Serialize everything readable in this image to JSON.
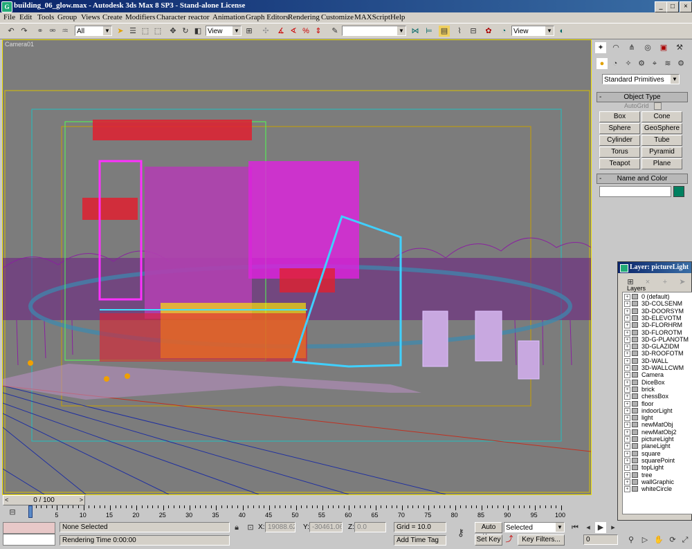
{
  "window": {
    "title": "building_06_glow.max - Autodesk 3ds Max 8 SP3  -  Stand-alone License",
    "minimize": "_",
    "maximize": "□",
    "close": "×"
  },
  "menu": [
    "File",
    "Edit",
    "Tools",
    "Group",
    "Views",
    "Create",
    "Modifiers",
    "Character",
    "reactor",
    "Animation",
    "Graph Editors",
    "Rendering",
    "Customize",
    "MAXScript",
    "Help"
  ],
  "toolbar": {
    "selection_filter": "All",
    "ref_coord": "View",
    "named_selection": "",
    "render_view": "View"
  },
  "viewport": {
    "label": "Camera01",
    "background": "#7c7c7c"
  },
  "command_panel": {
    "category": "Standard Primitives",
    "object_type_header": "Object Type",
    "autogrid_label": "AutoGrid",
    "buttons": [
      "Box",
      "Cone",
      "Sphere",
      "GeoSphere",
      "Cylinder",
      "Tube",
      "Torus",
      "Pyramid",
      "Teapot",
      "Plane"
    ],
    "name_color_header": "Name and Color",
    "object_name": "",
    "object_color": "#008060"
  },
  "layer_window": {
    "title": "Layer: pictureLight",
    "header": "Layers",
    "layers": [
      "0 (default)",
      "3D-COLSENM",
      "3D-DOORSYM",
      "3D-ELEVOTM",
      "3D-FLORHRM",
      "3D-FLOROTM",
      "3D-G-PLANOTM",
      "3D-GLAZIDM",
      "3D-ROOFOTM",
      "3D-WALL",
      "3D-WALLCWM",
      "Camera",
      "DiceBox",
      "brick",
      "chessBox",
      "floor",
      "indoorLight",
      "light",
      "newMatObj",
      "newMatObj2",
      "pictureLight",
      "planeLight",
      "square",
      "squarePoint",
      "topLight",
      "tree",
      "wallGraphic",
      "whiteCircle"
    ]
  },
  "timeline": {
    "slider_label": "0 / 100",
    "ticks": [
      "0",
      "5",
      "10",
      "15",
      "20",
      "25",
      "30",
      "35",
      "40",
      "45",
      "50",
      "55",
      "60",
      "65",
      "70",
      "75",
      "80",
      "85",
      "90",
      "95",
      "100"
    ]
  },
  "status": {
    "selection": "None Selected",
    "render_time": "Rendering Time  0:00:00",
    "x_label": "X:",
    "x_value": "19088.621",
    "y_label": "Y:",
    "y_value": "-30461.064",
    "z_label": "Z:",
    "z_value": "0.0",
    "grid": "Grid = 10.0",
    "add_time_tag": "Add Time Tag",
    "auto_key": "Auto Key",
    "set_key": "Set Key",
    "selected_dropdown": "Selected",
    "key_filters": "Key Filters...",
    "frame": "0"
  }
}
